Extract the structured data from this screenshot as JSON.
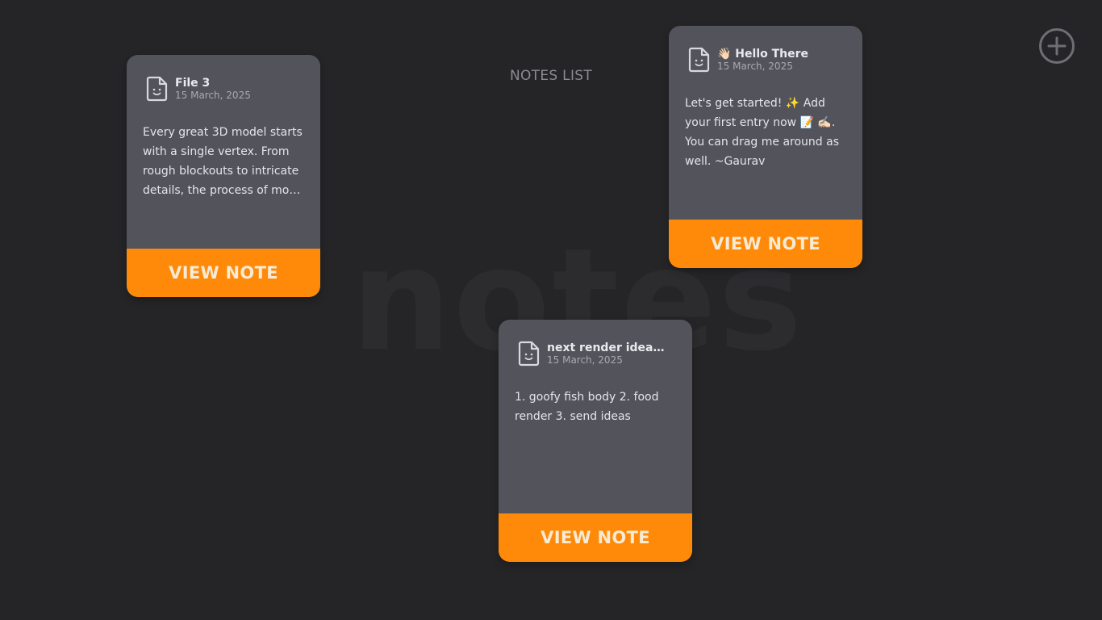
{
  "app": {
    "watermark": "notes",
    "list_title": "NOTES LIST",
    "add_button_icon": "plus-circle-icon"
  },
  "notes": [
    {
      "title": "File 3",
      "date": "15 March, 2025",
      "body": "Every great 3D model starts with a single vertex. From rough blockouts to intricate details, the process of mo…",
      "button_label": "VIEW NOTE"
    },
    {
      "title": "👋🏻 Hello There",
      "date": "15 March, 2025",
      "body": "Let's get started! ✨ Add your first entry now 📝 ✍🏻. You can drag me around as well. ~Gaurav",
      "button_label": "VIEW NOTE"
    },
    {
      "title": "next render idea…",
      "date": "15 March, 2025",
      "body": "1. goofy fish body 2. food render 3. send ideas",
      "button_label": "VIEW NOTE"
    }
  ],
  "colors": {
    "background": "#252527",
    "card": "#53535c",
    "accent": "#ff8a09",
    "muted_text": "#8b8b90"
  }
}
